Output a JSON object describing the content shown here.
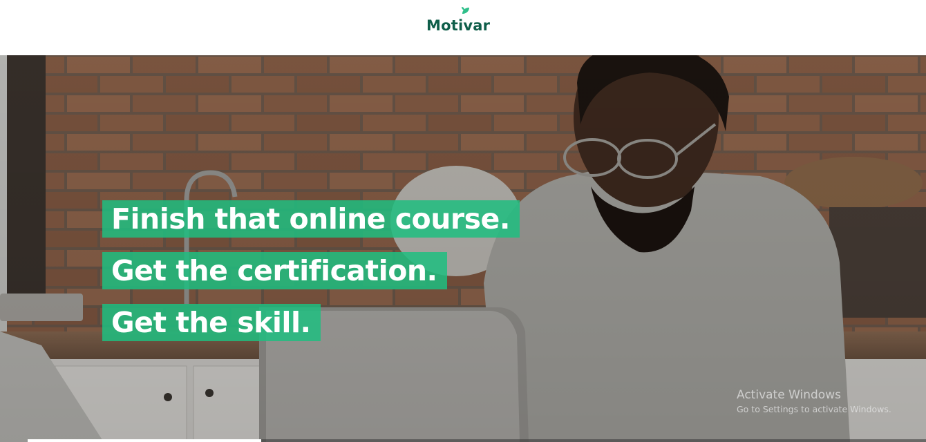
{
  "brand": {
    "name": "Motivar",
    "color": "#0f5e4a",
    "leaf_color": "#2fbf8a"
  },
  "hero": {
    "headlines": [
      "Finish that online course.",
      "Get the certification.",
      "Get the skill."
    ],
    "highlight_color": "#1ebe80",
    "slide_progress": 0.26
  },
  "system_overlay": {
    "title": "Activate Windows",
    "subtitle": "Go to Settings to activate Windows."
  }
}
